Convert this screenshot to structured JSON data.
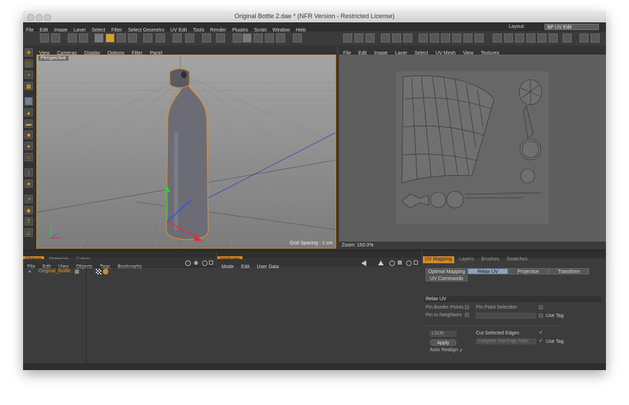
{
  "window": {
    "title": "Original Bottle 2.dae * (NFR Version - Restricted License)"
  },
  "menubar": {
    "items": [
      "File",
      "Edit",
      "Image",
      "Layer",
      "Select",
      "Filter",
      "Select Geometry",
      "UV Edit",
      "Tools",
      "Render",
      "Plugins",
      "Script",
      "Window",
      "Help"
    ],
    "layout_label": "Layout:",
    "layout_value": "BP UV Edit"
  },
  "viewport": {
    "menu": [
      "View",
      "Cameras",
      "Display",
      "Options",
      "Filter",
      "Panel"
    ],
    "camera_label": "Perspective",
    "grid_spacing": "Grid Spacing : 1 cm"
  },
  "uv_editor": {
    "menu": [
      "File",
      "Edit",
      "Image",
      "Layer",
      "Select",
      "UV Mesh",
      "View",
      "Textures"
    ],
    "zoom": "Zoom: 150.0%"
  },
  "objects_panel": {
    "tabs": [
      "Objects",
      "Materials",
      "Colors"
    ],
    "menu": [
      "File",
      "Edit",
      "View",
      "Objects",
      "Tags",
      "Bookmarks"
    ],
    "object_name": "Original_Bottle"
  },
  "attributes_panel": {
    "tabs": [
      "Attributes"
    ],
    "menu": [
      "Mode",
      "Edit",
      "User Data"
    ]
  },
  "uv_panel": {
    "tabs": [
      "UV Mapping",
      "Layers",
      "Brushes",
      "Swatches"
    ],
    "subtabs": [
      "Optimal Mapping",
      "Relax UV",
      "Projection",
      "Transform",
      "UV Commands"
    ],
    "section": "Relax UV",
    "pin_border": "Pin Border Points",
    "pin_neighbors": "Pin to Neighbors",
    "pin_point_selection": "Pin Point Selection",
    "use_tag_1": "Use Tag",
    "method": "LSCM",
    "apply": "Apply",
    "auto_realign": "Auto Realign",
    "cut_selected_edges": "Cut Selected Edges",
    "complete_total": "Complete Total Edge Selec",
    "use_tag_2": "Use Tag"
  }
}
